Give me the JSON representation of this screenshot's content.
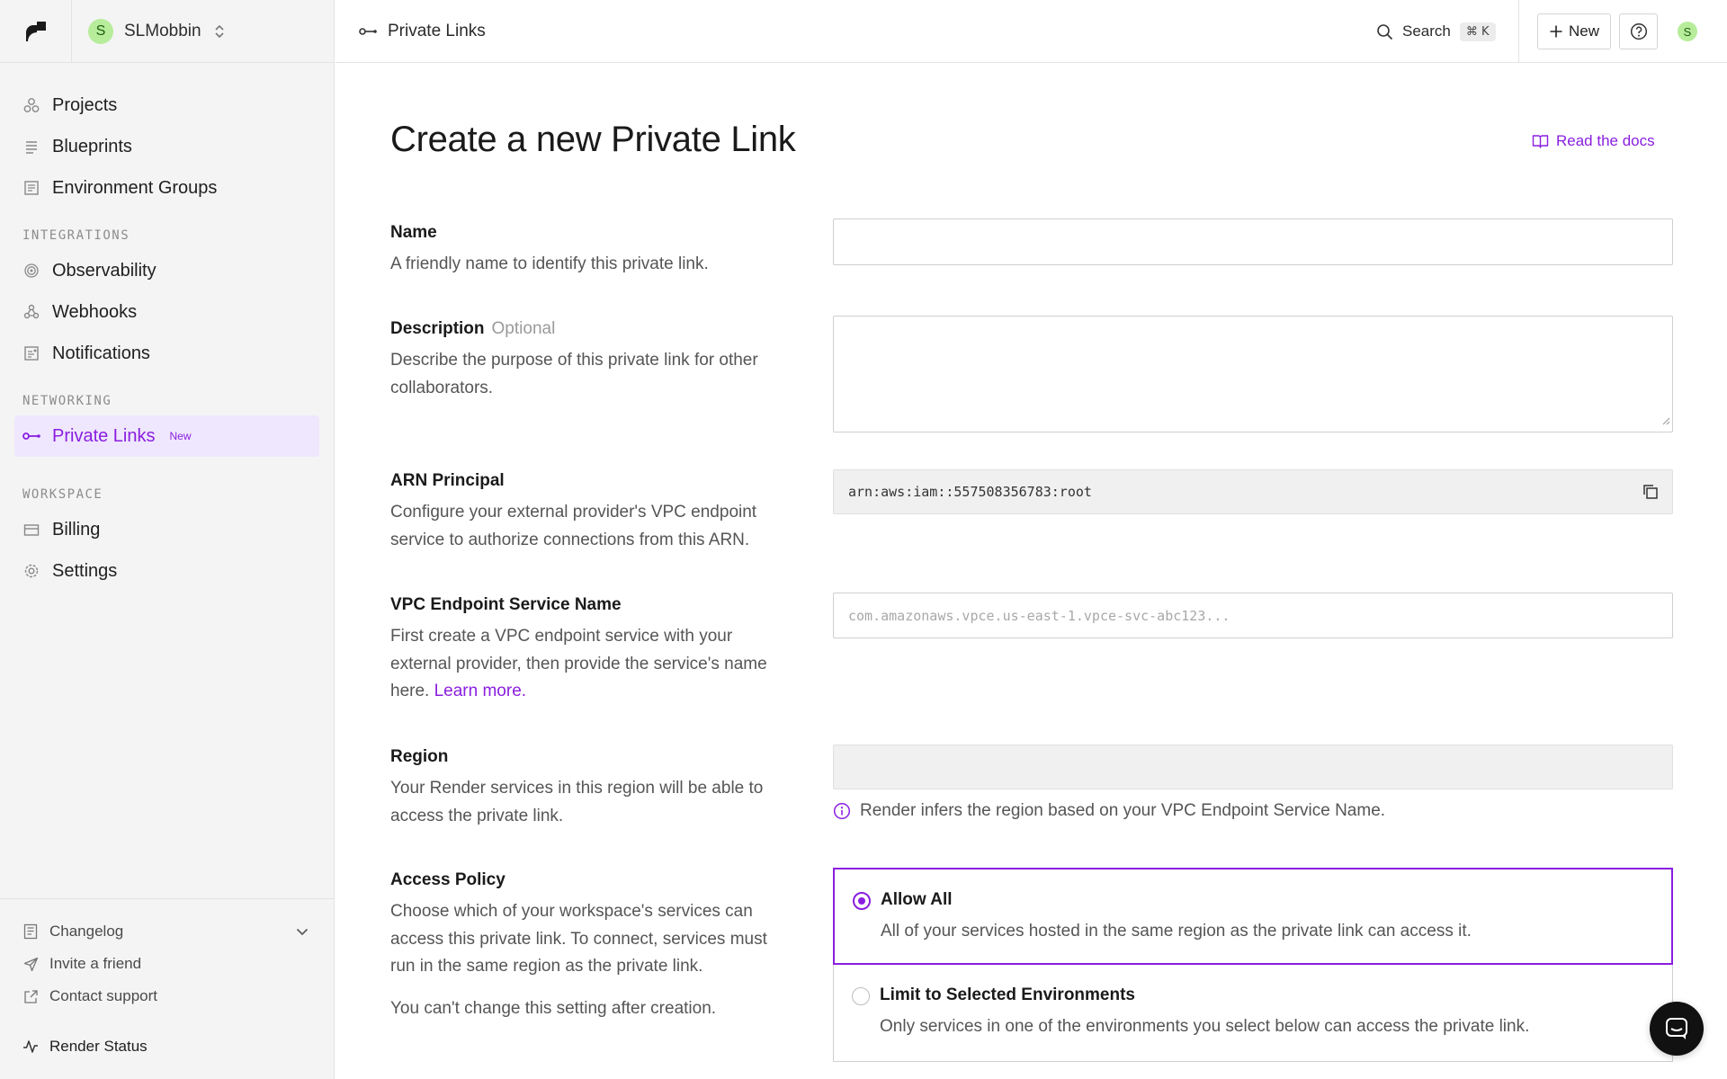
{
  "workspace": {
    "avatar_letter": "S",
    "name": "SLMobbin"
  },
  "sidebar": {
    "top_items": [
      {
        "label": "Projects",
        "icon": "projects-icon"
      },
      {
        "label": "Blueprints",
        "icon": "blueprints-icon"
      },
      {
        "label": "Environment Groups",
        "icon": "environment-groups-icon"
      }
    ],
    "sections": [
      {
        "title": "INTEGRATIONS",
        "items": [
          {
            "label": "Observability",
            "icon": "observability-icon"
          },
          {
            "label": "Webhooks",
            "icon": "webhooks-icon"
          },
          {
            "label": "Notifications",
            "icon": "notifications-icon"
          }
        ]
      },
      {
        "title": "NETWORKING",
        "items": [
          {
            "label": "Private Links",
            "icon": "private-links-icon",
            "badge": "New",
            "active": true
          }
        ]
      },
      {
        "title": "WORKSPACE",
        "items": [
          {
            "label": "Billing",
            "icon": "billing-icon"
          },
          {
            "label": "Settings",
            "icon": "settings-icon"
          }
        ]
      }
    ],
    "footer": {
      "changelog": "Changelog",
      "invite": "Invite a friend",
      "support": "Contact support",
      "status": "Render Status"
    }
  },
  "topbar": {
    "breadcrumb": "Private Links",
    "search_label": "Search",
    "search_shortcut": "⌘ K",
    "new_label": "New",
    "user_avatar": "S"
  },
  "page": {
    "title": "Create a new Private Link",
    "docs_link": "Read the docs"
  },
  "form": {
    "name": {
      "label": "Name",
      "help": "A friendly name to identify this private link.",
      "value": ""
    },
    "description": {
      "label": "Description",
      "optional": "Optional",
      "help": "Describe the purpose of this private link for other collaborators.",
      "value": ""
    },
    "arn": {
      "label": "ARN Principal",
      "help": "Configure your external provider's VPC endpoint service to authorize connections from this ARN.",
      "value": "arn:aws:iam::557508356783:root"
    },
    "vpc": {
      "label": "VPC Endpoint Service Name",
      "help_prefix": "First create a VPC endpoint service with your external provider, then provide the service's name here.",
      "help_link": "Learn more.",
      "placeholder": "com.amazonaws.vpce.us-east-1.vpce-svc-abc123..."
    },
    "region": {
      "label": "Region",
      "help": "Your Render services in this region will be able to access the private link.",
      "value": "",
      "note": "Render infers the region based on your VPC Endpoint Service Name."
    },
    "access_policy": {
      "label": "Access Policy",
      "help": "Choose which of your workspace's services can access this private link. To connect, services must run in the same region as the private link.",
      "help_note": "You can't change this setting after creation.",
      "selected": "Allow All",
      "options": [
        {
          "title": "Allow All",
          "desc": "All of your services hosted in the same region as the private link can access it."
        },
        {
          "title": "Limit to Selected Environments",
          "desc": "Only services in one of the environments you select below can access the private link."
        }
      ]
    }
  },
  "colors": {
    "accent": "#8a1ee0",
    "sidebar_bg": "#f4f4f4",
    "active_bg": "#efe7fd",
    "avatar_bg": "#b6ec9a"
  }
}
